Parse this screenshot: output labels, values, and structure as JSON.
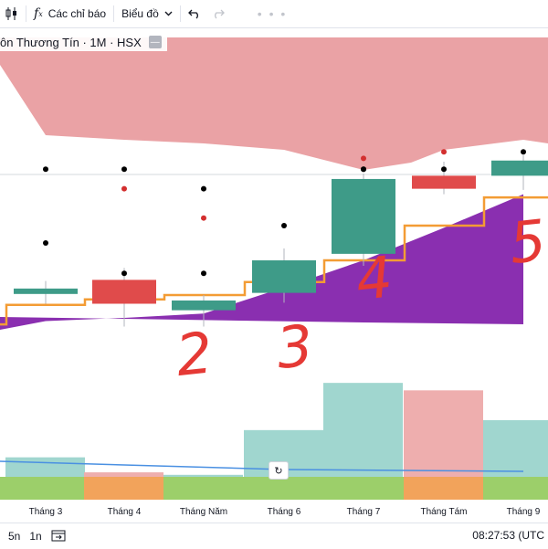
{
  "toolbar": {
    "indicators_label": "Các chỉ báo",
    "chart_type_label": "Biểu đồ",
    "more": "• • •"
  },
  "legend": {
    "text": "ôn Thương Tín · 1M · HSX"
  },
  "handwritten": [
    "2",
    "3",
    "4",
    "5"
  ],
  "colors": {
    "bull": "#3e9b88",
    "bear": "#e04b4b",
    "cloud": "#eaa2a5",
    "purple_area": "#8a2fb0",
    "step_line": "#f39c34",
    "volume_bull": "#a0d6cf",
    "volume_bear": "#eeaeae",
    "volume_ma": "#4a90e2",
    "green_band": "#9ccf6a",
    "orange_band": "#f2a35b",
    "annotation": "#e53935"
  },
  "chart_data": {
    "type": "candlestick",
    "categories": [
      "",
      "Tháng 3",
      "Tháng 4",
      "Tháng Năm",
      "Tháng 6",
      "Tháng 7",
      "Tháng Tám",
      "Tháng 9"
    ],
    "ohlc": [
      {
        "o": 0.3,
        "h": 0.3,
        "l": 0.3,
        "c": 0.3
      },
      {
        "o": 0.63,
        "h": 0.7,
        "l": 0.59,
        "c": 0.68
      },
      {
        "o": 0.76,
        "h": 0.82,
        "l": 0.38,
        "c": 0.54
      },
      {
        "o": 0.48,
        "h": 0.55,
        "l": 0.38,
        "c": 0.57
      },
      {
        "o": 0.64,
        "h": 1.0,
        "l": 0.6,
        "c": 0.94
      },
      {
        "o": 1.0,
        "h": 1.48,
        "l": 0.94,
        "c": 1.69
      },
      {
        "o": 1.72,
        "h": 1.8,
        "l": 1.6,
        "c": 1.6
      },
      {
        "o": 1.72,
        "h": 1.84,
        "l": 1.64,
        "c": 1.86
      }
    ],
    "volume": [
      0.17,
      0.17,
      0.11,
      0.1,
      0.28,
      0.47,
      0.44,
      0.32
    ],
    "step_line": [
      0.35,
      0.53,
      0.58,
      0.62,
      0.74,
      0.94,
      1.26,
      1.52
    ],
    "purple_area_top": [
      0.3,
      0.38,
      0.41,
      0.45,
      0.69,
      0.94,
      1.24,
      1.55
    ],
    "dots_black": [
      [
        1,
        1.78
      ],
      [
        1,
        1.1
      ],
      [
        2,
        1.78
      ],
      [
        2,
        0.82
      ],
      [
        3,
        1.6
      ],
      [
        3,
        0.82
      ],
      [
        4,
        1.26
      ],
      [
        5,
        1.78
      ],
      [
        5,
        1.78
      ],
      [
        6,
        1.78
      ],
      [
        7,
        1.94
      ]
    ],
    "dots_red": [
      [
        2,
        1.6
      ],
      [
        3,
        1.33
      ],
      [
        5,
        1.88
      ],
      [
        6,
        1.94
      ]
    ]
  },
  "bottombar": {
    "range1": "5n",
    "range2": "1n",
    "time": "08:27:53 (UTC"
  }
}
